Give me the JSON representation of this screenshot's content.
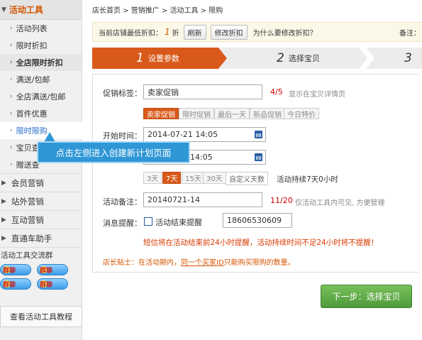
{
  "sidebar": {
    "header": "活动工具",
    "items": [
      {
        "label": "活动列表"
      },
      {
        "label": "限时折扣"
      },
      {
        "label": "全店限时折扣"
      },
      {
        "label": "满送/包邮"
      },
      {
        "label": "全店满送/包邮"
      },
      {
        "label": "首件优惠"
      },
      {
        "label": "限时限购"
      },
      {
        "label": "宝贝查"
      },
      {
        "label": "赠送查"
      }
    ],
    "groups": [
      "会员营销",
      "站外营销",
      "互动营销",
      "直通车助手"
    ],
    "group_label": "活动工具交流群",
    "qq_label": "群聊",
    "tutorial_button": "查看活动工具教程"
  },
  "breadcrumb": "店长首页 > 营销推广 > 活动工具 > 限购",
  "notice": {
    "prefix": "当前店铺最低折扣：",
    "value": "1",
    "suffix": "折",
    "refresh": "刷新",
    "edit": "修改折扣",
    "question": "为什么要修改折扣？",
    "note": "备注："
  },
  "steps": [
    {
      "num": "1",
      "label": "设置参数"
    },
    {
      "num": "2",
      "label": "选择宝贝"
    },
    {
      "num": "3",
      "label": ""
    }
  ],
  "form": {
    "tag_label": "促销标签：",
    "tag_value": "卖家促销",
    "tag_count": "4/5",
    "tag_hint": "显示在宝贝详情页",
    "tag_options": [
      "卖家促销",
      "限时促销",
      "最后一天",
      "新品促销",
      "今日特价"
    ],
    "start_label": "开始时间：",
    "start_value": "2014-07-21 14:05",
    "end_value": "14:05",
    "durations": [
      "3天",
      "7天",
      "15天",
      "30天"
    ],
    "custom_days": "自定义天数",
    "duration_text": "活动持续7天0小时",
    "remark_label": "活动备注：",
    "remark_value": "20140721-14",
    "remark_count": "11/20",
    "remark_hint": "仅活动工具内可见, 方便管理",
    "reminder_label": "消息提醒：",
    "reminder_check": "活动结束提醒",
    "phone": "18606530609",
    "sms_warning": "短信将在活动结束前24小时提醒，活动持续时间不足24小时将不提醒！",
    "tip_prefix": "店长贴士：在活动期内，",
    "tip_link": "同一个买家ID",
    "tip_suffix": "只能购买限购的数量。"
  },
  "next_button": "下一步：选择宝贝",
  "callout": "点击左侧进入创建新计划页面",
  "colors": {
    "accent": "#d9591a",
    "link": "#2a6ec8",
    "callout": "#2f97d6",
    "next": "#4e9a3a"
  }
}
